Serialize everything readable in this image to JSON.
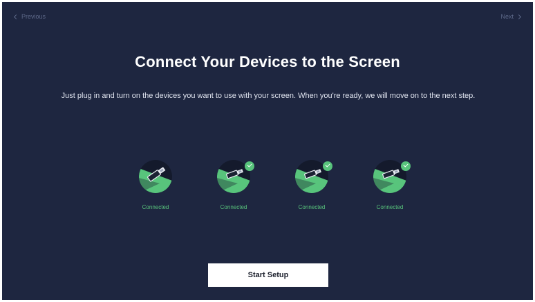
{
  "nav": {
    "previous_label": "Previous",
    "next_label": "Next"
  },
  "main": {
    "title": "Connect Your Devices to the Screen",
    "description": "Just plug in and turn on the devices you want to use with your screen. When you're ready, we will move on to the next step."
  },
  "devices": [
    {
      "status": "Connected",
      "icon": "hdmi-cable-icon",
      "checked": false
    },
    {
      "status": "Connected",
      "icon": "hdmi-cable-icon",
      "checked": true
    },
    {
      "status": "Connected",
      "icon": "hdmi-cable-icon",
      "checked": true
    },
    {
      "status": "Connected",
      "icon": "hdmi-cable-icon",
      "checked": true
    }
  ],
  "footer": {
    "start_label": "Start Setup"
  },
  "colors": {
    "background": "#1e2640",
    "accent_green": "#58c47c",
    "nav_text": "#5d6888",
    "button_bg": "#ffffff"
  }
}
